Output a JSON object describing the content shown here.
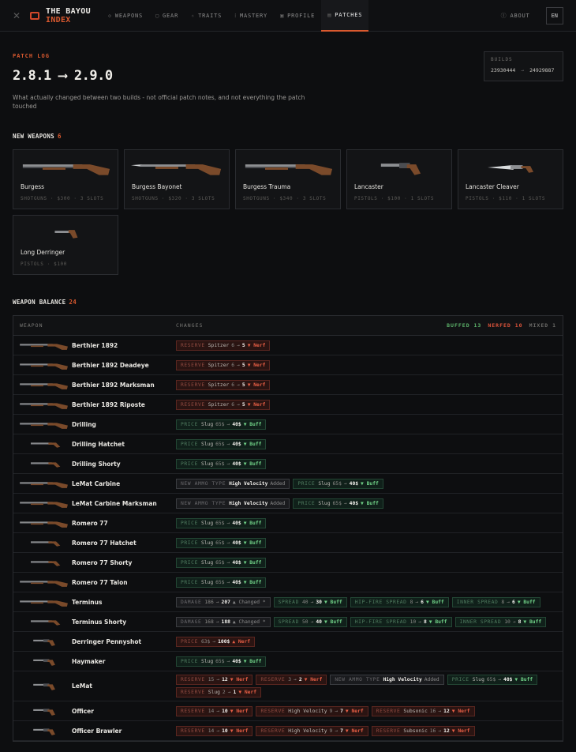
{
  "brand": {
    "line1": "THE BAYOU",
    "line2": "INDEX"
  },
  "nav": [
    {
      "label": "WEAPONS",
      "icon": "crosshair-icon",
      "glyph": "◇"
    },
    {
      "label": "GEAR",
      "icon": "lock-icon",
      "glyph": "▢"
    },
    {
      "label": "TRAITS",
      "icon": "sparkle-icon",
      "glyph": "✧"
    },
    {
      "label": "MASTERY",
      "icon": "bars-icon",
      "glyph": "⁞"
    },
    {
      "label": "PROFILE",
      "icon": "profile-icon",
      "glyph": "▣"
    },
    {
      "label": "PATCHES",
      "icon": "document-icon",
      "glyph": "▤",
      "active": true
    }
  ],
  "about_label": "ABOUT",
  "lang": "EN",
  "eyebrow": "PATCH LOG",
  "title": "2.8.1 ⟶ 2.9.0",
  "lede": "What actually changed between two builds - not official patch notes, and not everything the patch touched",
  "builds": {
    "label": "BUILDS",
    "from": "23930444",
    "sep": "→",
    "to": "24929887"
  },
  "new_weapons": {
    "heading": "NEW WEAPONS",
    "count": "6",
    "items": [
      {
        "name": "Burgess",
        "meta": "SHOTGUNS · $300 · 3 SLOTS",
        "shape": "long"
      },
      {
        "name": "Burgess Bayonet",
        "meta": "SHOTGUNS · $320 · 3 SLOTS",
        "shape": "bayonet"
      },
      {
        "name": "Burgess Trauma",
        "meta": "SHOTGUNS · $340 · 3 SLOTS",
        "shape": "long"
      },
      {
        "name": "Lancaster",
        "meta": "PISTOLS · $100 · 1 SLOTS",
        "shape": "pistol"
      },
      {
        "name": "Lancaster Cleaver",
        "meta": "PISTOLS · $110 · 1 SLOTS",
        "shape": "knife"
      },
      {
        "name": "Long Derringer",
        "meta": "PISTOLS · $100",
        "shape": "small"
      }
    ]
  },
  "balance": {
    "heading": "WEAPON BALANCE",
    "count": "24",
    "col_weapon": "WEAPON",
    "col_changes": "CHANGES",
    "legend": {
      "buffed": "BUFFED 13",
      "nerfed": "NERFED 10",
      "mixed": "MIXED 1"
    },
    "rows": [
      {
        "name": "Berthier 1892",
        "shape": "rifle",
        "changes": [
          {
            "kind": "nerf",
            "key": "RESERVE",
            "label": "Spitzer",
            "from": "6",
            "to": "5",
            "verdict": "▼ Nerf"
          }
        ]
      },
      {
        "name": "Berthier 1892 Deadeye",
        "shape": "rifle",
        "changes": [
          {
            "kind": "nerf",
            "key": "RESERVE",
            "label": "Spitzer",
            "from": "6",
            "to": "5",
            "verdict": "▼ Nerf"
          }
        ]
      },
      {
        "name": "Berthier 1892 Marksman",
        "shape": "rifle",
        "changes": [
          {
            "kind": "nerf",
            "key": "RESERVE",
            "label": "Spitzer",
            "from": "6",
            "to": "5",
            "verdict": "▼ Nerf"
          }
        ]
      },
      {
        "name": "Berthier 1892 Riposte",
        "shape": "rifle",
        "changes": [
          {
            "kind": "nerf",
            "key": "RESERVE",
            "label": "Spitzer",
            "from": "6",
            "to": "5",
            "verdict": "▼ Nerf"
          }
        ]
      },
      {
        "name": "Drilling",
        "shape": "rifle",
        "changes": [
          {
            "kind": "buff",
            "key": "PRICE",
            "label": "Slug",
            "from": "65$",
            "to": "40$",
            "verdict": "▼ Buff"
          }
        ]
      },
      {
        "name": "Drilling Hatchet",
        "shape": "short",
        "changes": [
          {
            "kind": "buff",
            "key": "PRICE",
            "label": "Slug",
            "from": "65$",
            "to": "40$",
            "verdict": "▼ Buff"
          }
        ]
      },
      {
        "name": "Drilling Shorty",
        "shape": "short",
        "changes": [
          {
            "kind": "buff",
            "key": "PRICE",
            "label": "Slug",
            "from": "65$",
            "to": "40$",
            "verdict": "▼ Buff"
          }
        ]
      },
      {
        "name": "LeMat Carbine",
        "shape": "rifle",
        "changes": [
          {
            "kind": "mix",
            "key": "NEW AMMO TYPE",
            "label": "",
            "from": "",
            "to": "High Velocity",
            "verdict": "Added"
          },
          {
            "kind": "buff",
            "key": "PRICE",
            "label": "Slug",
            "from": "65$",
            "to": "40$",
            "verdict": "▼ Buff"
          }
        ]
      },
      {
        "name": "LeMat Carbine Marksman",
        "shape": "rifle",
        "changes": [
          {
            "kind": "mix",
            "key": "NEW AMMO TYPE",
            "label": "",
            "from": "",
            "to": "High Velocity",
            "verdict": "Added"
          },
          {
            "kind": "buff",
            "key": "PRICE",
            "label": "Slug",
            "from": "65$",
            "to": "40$",
            "verdict": "▼ Buff"
          }
        ]
      },
      {
        "name": "Romero 77",
        "shape": "rifle",
        "changes": [
          {
            "kind": "buff",
            "key": "PRICE",
            "label": "Slug",
            "from": "65$",
            "to": "40$",
            "verdict": "▼ Buff"
          }
        ]
      },
      {
        "name": "Romero 77 Hatchet",
        "shape": "short",
        "changes": [
          {
            "kind": "buff",
            "key": "PRICE",
            "label": "Slug",
            "from": "65$",
            "to": "40$",
            "verdict": "▼ Buff"
          }
        ]
      },
      {
        "name": "Romero 77 Shorty",
        "shape": "short",
        "changes": [
          {
            "kind": "buff",
            "key": "PRICE",
            "label": "Slug",
            "from": "65$",
            "to": "40$",
            "verdict": "▼ Buff"
          }
        ]
      },
      {
        "name": "Romero 77 Talon",
        "shape": "rifle",
        "changes": [
          {
            "kind": "buff",
            "key": "PRICE",
            "label": "Slug",
            "from": "65$",
            "to": "40$",
            "verdict": "▼ Buff"
          }
        ]
      },
      {
        "name": "Terminus",
        "shape": "rifle",
        "changes": [
          {
            "kind": "mix",
            "key": "DAMAGE",
            "label": "",
            "from": "186",
            "to": "207",
            "verdict": "▲ Changed *"
          },
          {
            "kind": "buff",
            "key": "SPREAD",
            "label": "",
            "from": "40",
            "to": "30",
            "verdict": "▼ Buff"
          },
          {
            "kind": "buff",
            "key": "HIP-FIRE SPREAD",
            "label": "",
            "from": "8",
            "to": "6",
            "verdict": "▼ Buff"
          },
          {
            "kind": "buff",
            "key": "INNER SPREAD",
            "label": "",
            "from": "8",
            "to": "6",
            "verdict": "▼ Buff"
          }
        ]
      },
      {
        "name": "Terminus Shorty",
        "shape": "short",
        "changes": [
          {
            "kind": "mix",
            "key": "DAMAGE",
            "label": "",
            "from": "168",
            "to": "188",
            "verdict": "▲ Changed *"
          },
          {
            "kind": "buff",
            "key": "SPREAD",
            "label": "",
            "from": "50",
            "to": "40",
            "verdict": "▼ Buff"
          },
          {
            "kind": "buff",
            "key": "HIP-FIRE SPREAD",
            "label": "",
            "from": "10",
            "to": "8",
            "verdict": "▼ Buff"
          },
          {
            "kind": "buff",
            "key": "INNER SPREAD",
            "label": "",
            "from": "10",
            "to": "8",
            "verdict": "▼ Buff"
          }
        ]
      },
      {
        "name": "Derringer Pennyshot",
        "shape": "pistol",
        "changes": [
          {
            "kind": "nerf",
            "key": "PRICE",
            "label": "",
            "from": "63$",
            "to": "100$",
            "verdict": "▲ Nerf"
          }
        ]
      },
      {
        "name": "Haymaker",
        "shape": "pistol",
        "changes": [
          {
            "kind": "buff",
            "key": "PRICE",
            "label": "Slug",
            "from": "65$",
            "to": "40$",
            "verdict": "▼ Buff"
          }
        ]
      },
      {
        "name": "LeMat",
        "shape": "pistol",
        "changes": [
          {
            "kind": "nerf",
            "key": "RESERVE",
            "label": "",
            "from": "15",
            "to": "12",
            "verdict": "▼ Nerf"
          },
          {
            "kind": "nerf",
            "key": "RESERVE",
            "label": "",
            "from": "3",
            "to": "2",
            "verdict": "▼ Nerf"
          },
          {
            "kind": "mix",
            "key": "NEW AMMO TYPE",
            "label": "",
            "from": "",
            "to": "High Velocity",
            "verdict": "Added"
          },
          {
            "kind": "buff",
            "key": "PRICE",
            "label": "Slug",
            "from": "65$",
            "to": "40$",
            "verdict": "▼ Buff"
          },
          {
            "kind": "nerf",
            "key": "RESERVE",
            "label": "Slug",
            "from": "2",
            "to": "1",
            "verdict": "▼ Nerf"
          }
        ]
      },
      {
        "name": "Officer",
        "shape": "pistol",
        "changes": [
          {
            "kind": "nerf",
            "key": "RESERVE",
            "label": "",
            "from": "14",
            "to": "10",
            "verdict": "▼ Nerf"
          },
          {
            "kind": "nerf",
            "key": "RESERVE",
            "label": "High Velocity",
            "from": "9",
            "to": "7",
            "verdict": "▼ Nerf"
          },
          {
            "kind": "nerf",
            "key": "RESERVE",
            "label": "Subsonic",
            "from": "16",
            "to": "12",
            "verdict": "▼ Nerf"
          }
        ]
      },
      {
        "name": "Officer Brawler",
        "shape": "pistol",
        "changes": [
          {
            "kind": "nerf",
            "key": "RESERVE",
            "label": "",
            "from": "14",
            "to": "10",
            "verdict": "▼ Nerf"
          },
          {
            "kind": "nerf",
            "key": "RESERVE",
            "label": "High Velocity",
            "from": "9",
            "to": "7",
            "verdict": "▼ Nerf"
          },
          {
            "kind": "nerf",
            "key": "RESERVE",
            "label": "Subsonic",
            "from": "16",
            "to": "12",
            "verdict": "▼ Nerf"
          }
        ]
      }
    ]
  }
}
